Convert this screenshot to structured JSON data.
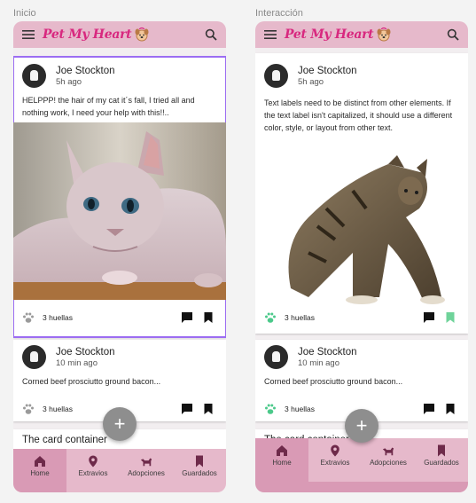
{
  "frames": [
    {
      "label": "Inicio"
    },
    {
      "label": "Interacción"
    }
  ],
  "app": {
    "brand": "Pet My Heart"
  },
  "feed_a": {
    "post1": {
      "author": "Joe Stockton",
      "time": "5h ago",
      "text": "HELPPP! the hair of my cat it´s fall, I tried all and nothing work, I need your help with this!!..",
      "likes": "3 huellas"
    },
    "post2": {
      "author": "Joe Stockton",
      "time": "10 min ago",
      "text": "Corned beef prosciutto ground bacon...",
      "likes": "3 huellas"
    },
    "post3": {
      "title": "The card container"
    }
  },
  "feed_b": {
    "post1": {
      "author": "Joe Stockton",
      "time": "5h ago",
      "text": "Text labels need to be distinct from other elements. If the text label isn't capitalized, it should use a different color, style, or layout from other text.",
      "likes": "3 huellas"
    },
    "post2": {
      "author": "Joe Stockton",
      "time": "10 min ago",
      "text": "Corned beef prosciutto ground bacon...",
      "likes": "3 huellas"
    },
    "post3": {
      "title": "The card container"
    }
  },
  "fab": {
    "symbol": "+"
  },
  "nav": {
    "home": "Home",
    "lost": "Extravios",
    "adopt": "Adopciones",
    "saved": "Guardados"
  },
  "colors": {
    "appbar": "#e6b9cb",
    "brand": "#d8287f",
    "nav_active": "#d99ab5",
    "selection": "#9c6df2",
    "paw_liked": "#4bc98a",
    "bookmark_saved": "#6fd39a"
  },
  "icons": [
    "menu-icon",
    "search-icon",
    "paw-icon",
    "comment-icon",
    "bookmark-icon",
    "home-icon",
    "location-icon",
    "dog-icon"
  ]
}
